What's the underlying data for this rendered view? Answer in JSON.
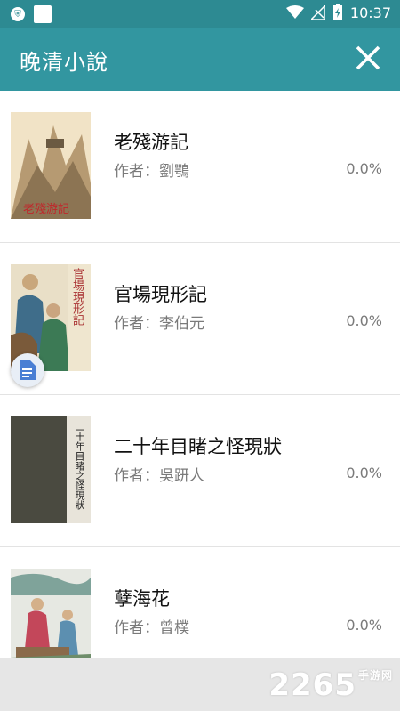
{
  "status": {
    "time": "10:37"
  },
  "header": {
    "title": "晚清小說"
  },
  "books": [
    {
      "title": "老殘游記",
      "author": "作者：劉鶚",
      "progress": "0.0%",
      "cover_text": "老殘游記"
    },
    {
      "title": "官場現形記",
      "author": "作者：李伯元",
      "progress": "0.0%",
      "cover_text": "官場現形記"
    },
    {
      "title": "二十年目睹之怪現狀",
      "author": "作者：吳趼人",
      "progress": "0.0%",
      "cover_text": "二十年目睹之怪現狀"
    },
    {
      "title": "孽海花",
      "author": "作者：曾樸",
      "progress": "0.0%"
    }
  ],
  "watermark": {
    "number": "2265",
    "suffix": "手游网"
  }
}
